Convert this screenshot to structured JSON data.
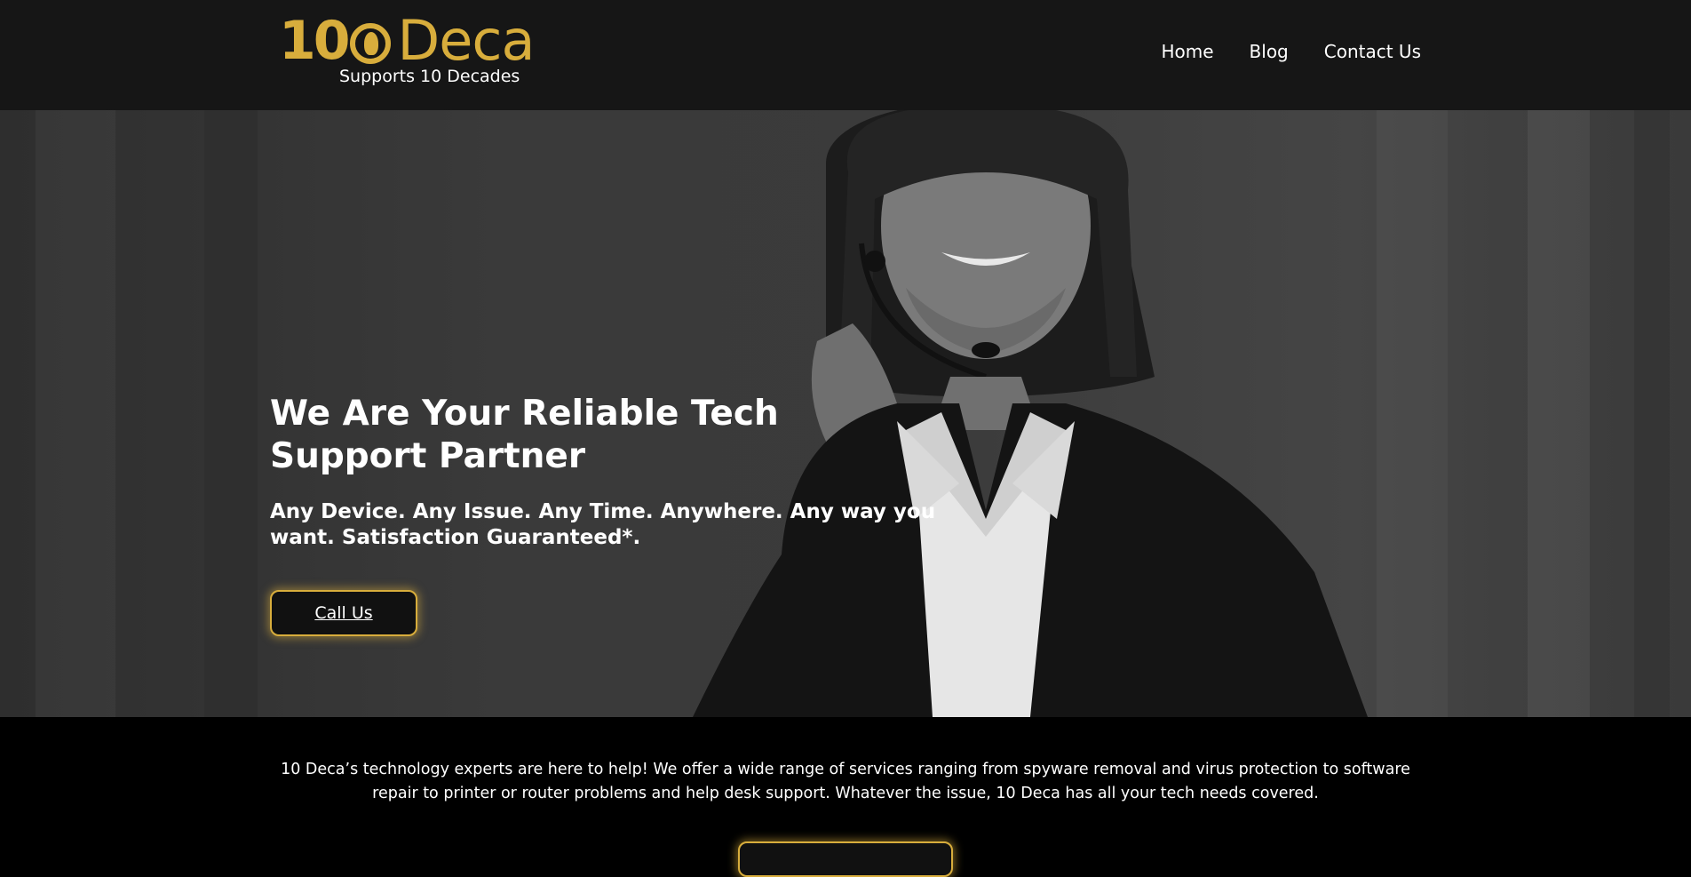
{
  "header": {
    "logo": {
      "number": "10",
      "word": "Deca",
      "tagline": "Supports 10 Decades"
    },
    "nav": [
      {
        "label": "Home"
      },
      {
        "label": "Blog"
      },
      {
        "label": "Contact Us"
      }
    ]
  },
  "hero": {
    "title": "We Are Your Reliable Tech Support Partner",
    "subtitle": "Any Device. Any Issue. Any Time. Anywhere. Any way you want. Satisfaction Guaranteed*.",
    "cta_label": "Call Us"
  },
  "intro": {
    "text": "10 Deca’s technology experts are here to help! We offer a wide range of services ranging from spyware removal and virus protection to software repair to printer or router problems and help desk support. Whatever the issue, 10 Deca has all your tech needs covered."
  },
  "colors": {
    "accent_gold": "#d8ad3c",
    "header_bg": "#161616",
    "page_bg": "#000000"
  }
}
